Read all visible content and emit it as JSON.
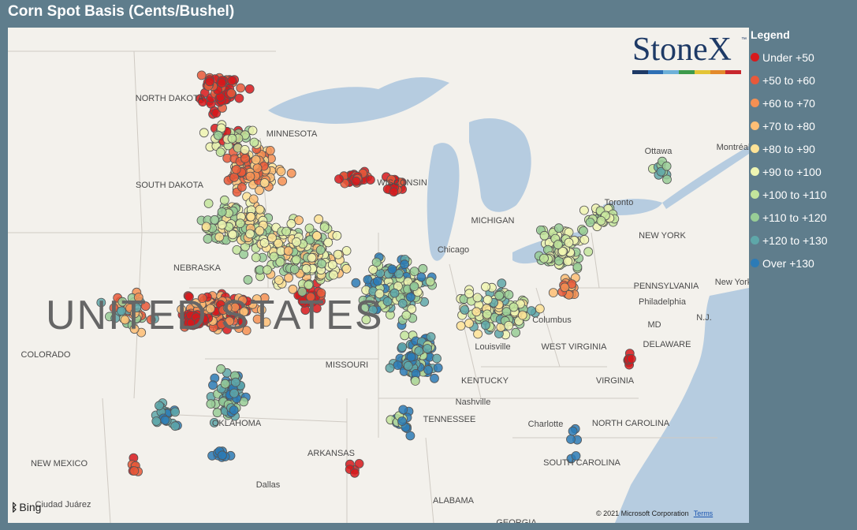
{
  "title": "Corn Spot Basis (Cents/Bushel)",
  "logo": {
    "text": "StoneX",
    "tm": "™",
    "bar_colors": [
      "#1e3a66",
      "#2e6fb4",
      "#6db0d8",
      "#3d9a4b",
      "#e3c436",
      "#e38a2b",
      "#c8272d"
    ]
  },
  "legend": {
    "title": "Legend",
    "items": [
      {
        "label": "Under +50",
        "color": "#d7191c"
      },
      {
        "label": "+50 to +60",
        "color": "#e8593a"
      },
      {
        "label": "+60 to +70",
        "color": "#f59053"
      },
      {
        "label": "+70 to +80",
        "color": "#fdbe75"
      },
      {
        "label": "+80 to +90",
        "color": "#fee397"
      },
      {
        "label": "+90 to +100",
        "color": "#eef5b2"
      },
      {
        "label": "+100 to +110",
        "color": "#c3e59c"
      },
      {
        "label": "+110 to +120",
        "color": "#98cd96"
      },
      {
        "label": "+120 to +130",
        "color": "#5ea7a9"
      },
      {
        "label": "Over +130",
        "color": "#2c7bb6"
      }
    ]
  },
  "map_labels": [
    {
      "text": "UNITED STATES",
      "big": true
    },
    {
      "text": "NORTH DAKOTA"
    },
    {
      "text": "SOUTH DAKOTA"
    },
    {
      "text": "MINNESOTA"
    },
    {
      "text": "WISCONSIN"
    },
    {
      "text": "MICHIGAN"
    },
    {
      "text": "NEBRASKA"
    },
    {
      "text": "COLORADO"
    },
    {
      "text": "MISSOURI"
    },
    {
      "text": "KENTUCKY"
    },
    {
      "text": "OKLAHOMA"
    },
    {
      "text": "ARKANSAS"
    },
    {
      "text": "TENNESSEE"
    },
    {
      "text": "NEW MEXICO"
    },
    {
      "text": "ALABAMA"
    },
    {
      "text": "GEORGIA"
    },
    {
      "text": "NORTH CAROLINA"
    },
    {
      "text": "SOUTH CAROLINA"
    },
    {
      "text": "VIRGINIA"
    },
    {
      "text": "WEST VIRGINIA"
    },
    {
      "text": "PENNSYLVANIA"
    },
    {
      "text": "NEW YORK"
    },
    {
      "text": "DELAWARE"
    },
    {
      "text": "MD"
    },
    {
      "text": "N.J."
    },
    {
      "text": "Chicago"
    },
    {
      "text": "Columbus"
    },
    {
      "text": "Louisville"
    },
    {
      "text": "Nashville"
    },
    {
      "text": "Charlotte"
    },
    {
      "text": "Philadelphia"
    },
    {
      "text": "New York"
    },
    {
      "text": "Toronto"
    },
    {
      "text": "Ottawa"
    },
    {
      "text": "Montréal"
    },
    {
      "text": "Dallas"
    },
    {
      "text": "Ciudad Juárez"
    }
  ],
  "attribution": {
    "bing": "Bing",
    "copyright": "© 2021 Microsoft Corporation",
    "terms": "Terms"
  }
}
